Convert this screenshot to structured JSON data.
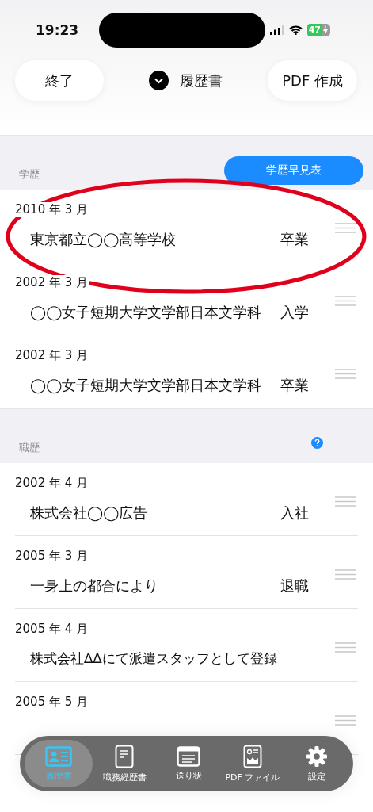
{
  "status_bar": {
    "time": "19:23",
    "battery": "47"
  },
  "header": {
    "left_button": "終了",
    "title": "履歴書",
    "right_button": "PDF 作成"
  },
  "sections": [
    {
      "label": "学歴",
      "action": {
        "kind": "button",
        "label": "学歴早見表"
      },
      "rows": [
        {
          "date": "2010 年 3 月",
          "text": "東京都立◯◯高等学校",
          "status": "卒業"
        },
        {
          "date": "2002 年 3 月",
          "text": "◯◯女子短期大学文学部日本文学科",
          "status": "入学"
        },
        {
          "date": "2002 年 3 月",
          "text": "◯◯女子短期大学文学部日本文学科",
          "status": "卒業"
        }
      ]
    },
    {
      "label": "職歴",
      "action": {
        "kind": "help"
      },
      "rows": [
        {
          "date": "2002 年 4 月",
          "text": "株式会社◯◯広告",
          "status": "入社"
        },
        {
          "date": "2005 年 3 月",
          "text": "一身上の都合により",
          "status": "退職"
        },
        {
          "date": "2005 年 4 月",
          "text": "株式会社∆∆にて派遣スタッフとして登録"
        },
        {
          "date": "2005 年 5 月"
        }
      ]
    }
  ],
  "annotation": {
    "kind": "ellipse"
  },
  "tab_bar": [
    {
      "kind": "resume",
      "label": "履歴書",
      "selected": true
    },
    {
      "kind": "document",
      "label": "職務経歴書",
      "selected": false
    },
    {
      "kind": "letter",
      "label": "送り状",
      "selected": false
    },
    {
      "kind": "pdf",
      "label": "PDF ファイル",
      "selected": false
    },
    {
      "kind": "settings",
      "label": "設定",
      "selected": false
    }
  ]
}
